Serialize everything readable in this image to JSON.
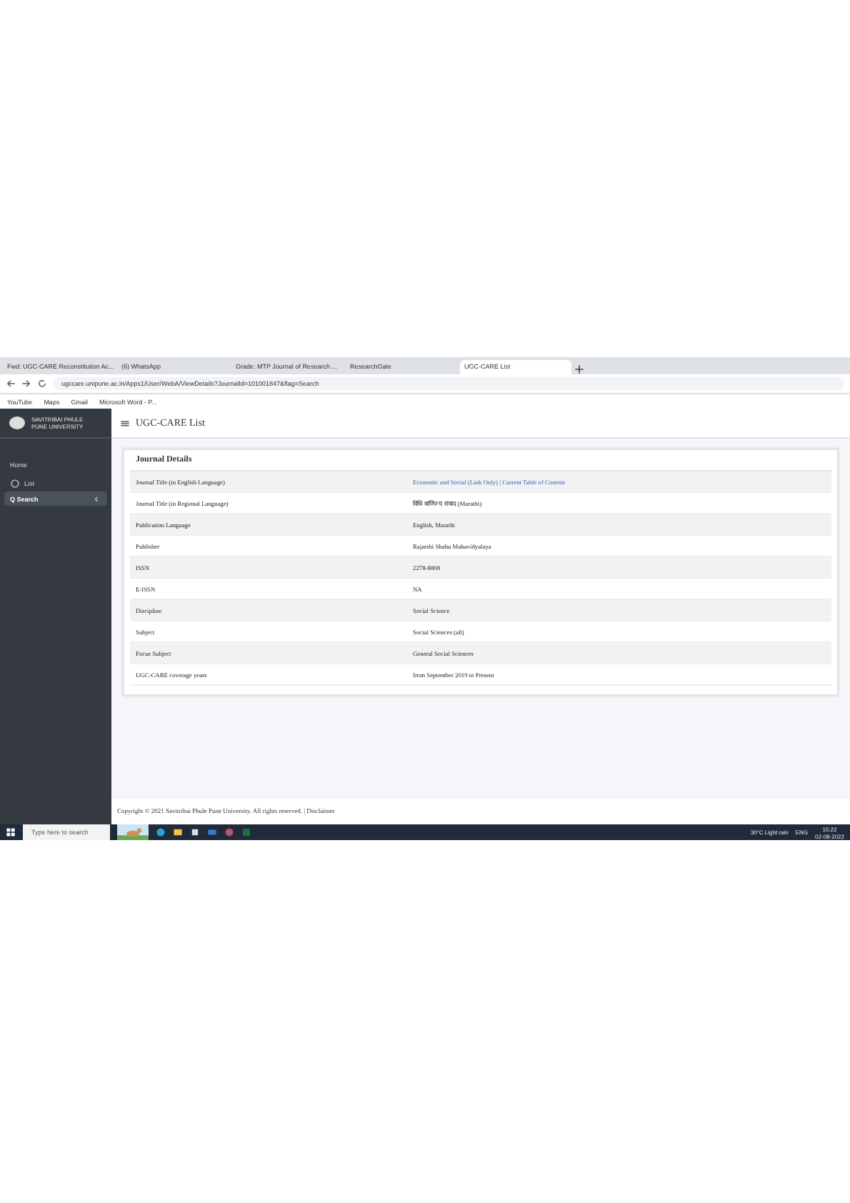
{
  "browser": {
    "tabs": [
      {
        "title": "Fwd: UGC-CARE Reconstitution Ac...",
        "selected": false
      },
      {
        "title": "(6) WhatsApp",
        "selected": false
      },
      {
        "title": "Grade: MTP Journal of Research ...",
        "selected": false
      },
      {
        "title": "ResearchGate",
        "selected": false
      },
      {
        "title": "UGC-CARE List",
        "selected": true
      }
    ],
    "url": "ugccare.unipune.ac.in/Apps1/User/WebA/ViewDetails?JournalId=101001847&flag=Search",
    "bookmarks": [
      "YouTube",
      "Maps",
      "Gmail",
      "Microsoft Word - P..."
    ]
  },
  "app": {
    "logo_text": "SAVITRIBAI PHULE PUNE UNIVERSITY",
    "title": "UGC-CARE List",
    "sidebar": [
      {
        "label": "Home",
        "kind": "heading"
      },
      {
        "label": "List",
        "kind": "radio",
        "selected": false
      },
      {
        "label": "Q Search",
        "kind": "expand",
        "selected": true
      }
    ],
    "card_title": "Journal Details",
    "rows": [
      {
        "label": "Journal Title (in English Language)",
        "value": "Economic and Social (Link Only) | Current Table of Content",
        "kind": "link"
      },
      {
        "label": "Journal Title (in Regional Language)",
        "value": "विधि वाणिज्य संवाद (Marathi)",
        "kind": "text"
      },
      {
        "label": "Publication Language",
        "value": "English, Marathi",
        "kind": "text"
      },
      {
        "label": "Publisher",
        "value": "Rajarshi Shahu Mahavidyalaya",
        "kind": "text"
      },
      {
        "label": "ISSN",
        "value": "2278-8808",
        "kind": "text"
      },
      {
        "label": "E-ISSN",
        "value": "NA",
        "kind": "text"
      },
      {
        "label": "Discipline",
        "value": "Social Science",
        "kind": "text"
      },
      {
        "label": "Subject",
        "value": "Social Sciences (all)",
        "kind": "text"
      },
      {
        "label": "Focus Subject",
        "value": "General Social Sciences",
        "kind": "text"
      },
      {
        "label": "UGC-CARE coverage years",
        "value": "from September 2019 to Present",
        "kind": "text"
      }
    ],
    "footer": "Copyright © 2021 Savitribai Phule Pune University. All rights reserved. | Disclaimer"
  },
  "taskbar": {
    "search_placeholder": "Type here to search",
    "weather": "30°C Light rain",
    "language": "ENG",
    "time": "15:22",
    "date": "02-08-2022"
  }
}
